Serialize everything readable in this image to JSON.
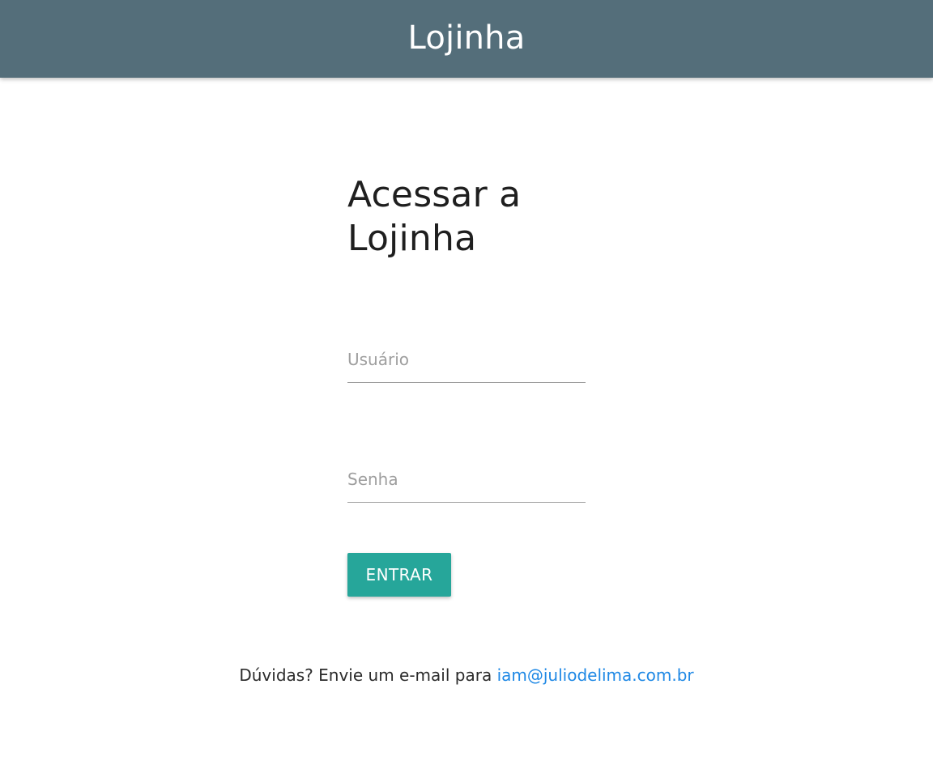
{
  "navbar": {
    "brand": "Lojinha"
  },
  "login": {
    "title": "Acessar a Lojinha",
    "username": {
      "placeholder": "Usuário",
      "value": ""
    },
    "password": {
      "placeholder": "Senha",
      "value": ""
    },
    "submit_label": "ENTRAR"
  },
  "footer": {
    "prefix": "Dúvidas? Envie um e-mail para ",
    "email": "iam@juliodelima.com.br"
  },
  "colors": {
    "navbar_bg": "#546e7a",
    "button_bg": "#26a69a",
    "link": "#1e88e5"
  }
}
